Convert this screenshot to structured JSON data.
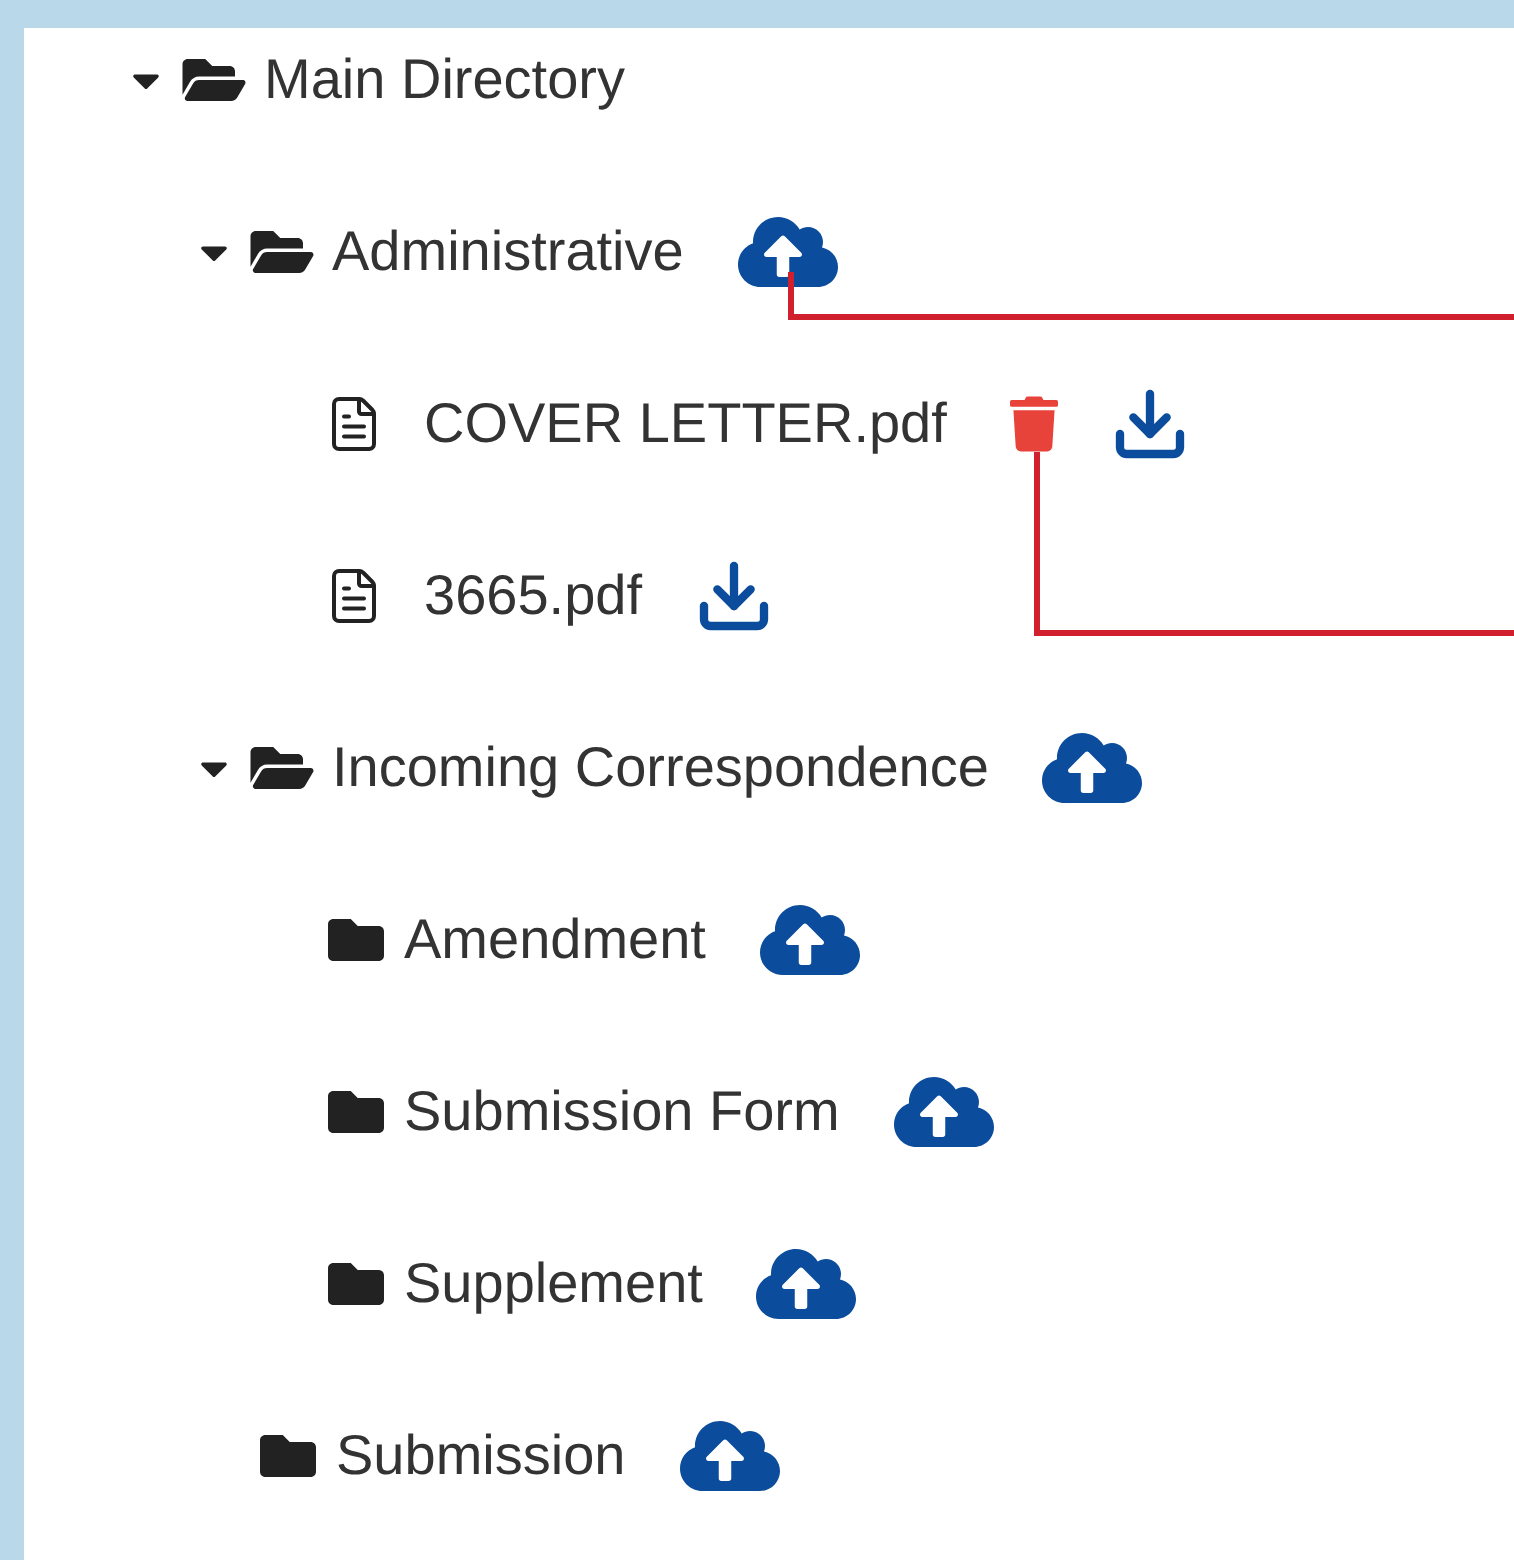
{
  "tree": [
    {
      "kind": "folder",
      "label": "Main Directory",
      "expanded": true,
      "children": [
        {
          "kind": "folder",
          "label": "Administrative",
          "expanded": true,
          "actions": [
            {
              "kind": "upload",
              "leader": true
            }
          ],
          "children": [
            {
              "kind": "file",
              "label": "COVER LETTER.pdf",
              "actions": [
                {
                  "kind": "delete",
                  "leader": true
                },
                {
                  "kind": "download"
                }
              ]
            },
            {
              "kind": "file",
              "label": "3665.pdf",
              "actions": [
                {
                  "kind": "download"
                }
              ]
            }
          ]
        },
        {
          "kind": "folder",
          "label": "Incoming Correspondence",
          "expanded": true,
          "actions": [
            {
              "kind": "upload"
            }
          ],
          "children": [
            {
              "kind": "folder",
              "label": "Amendment",
              "expanded": false,
              "actions": [
                {
                  "kind": "upload"
                }
              ]
            },
            {
              "kind": "folder",
              "label": "Submission Form",
              "expanded": false,
              "actions": [
                {
                  "kind": "upload"
                }
              ]
            },
            {
              "kind": "folder",
              "label": "Supplement",
              "expanded": false,
              "actions": [
                {
                  "kind": "upload"
                }
              ]
            }
          ]
        },
        {
          "kind": "folder",
          "label": "Submission",
          "expanded": false,
          "actions": [
            {
              "kind": "upload"
            }
          ]
        }
      ]
    }
  ]
}
